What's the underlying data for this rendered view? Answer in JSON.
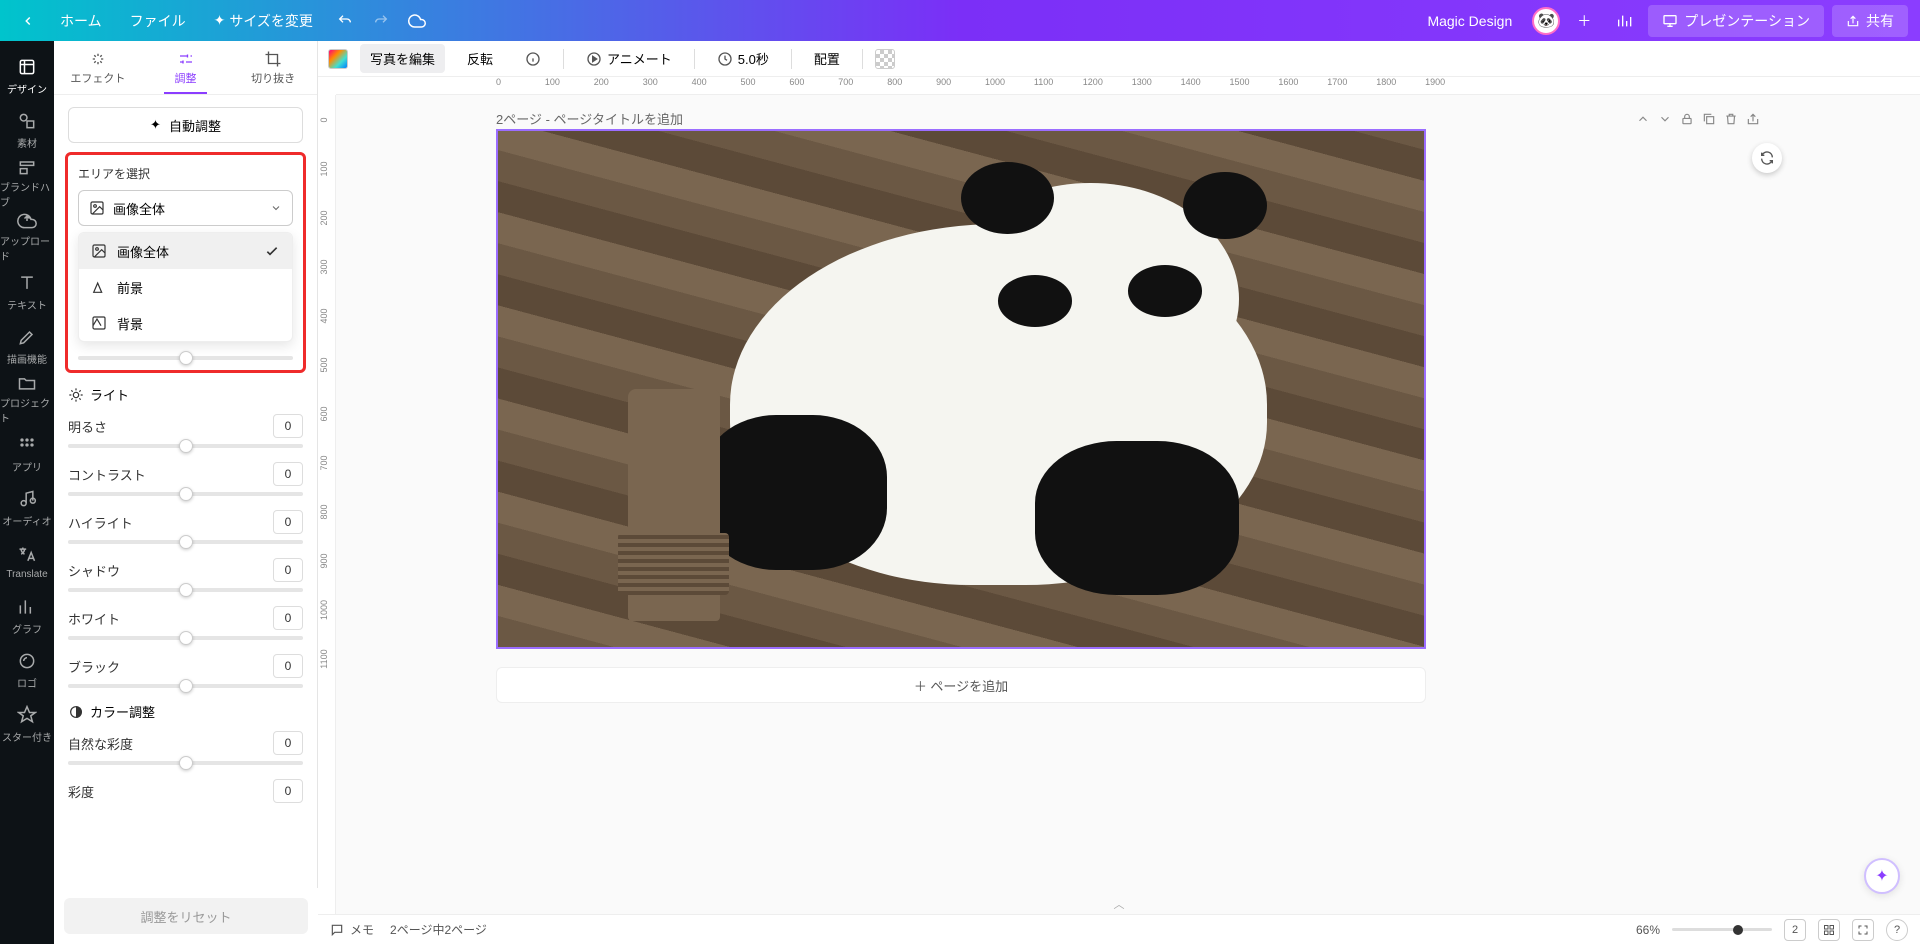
{
  "topbar": {
    "home": "ホーム",
    "file": "ファイル",
    "resize": "サイズを変更",
    "magic": "Magic Design",
    "present": "プレゼンテーション",
    "share": "共有"
  },
  "sidebar": {
    "items": [
      "デザイン",
      "素材",
      "ブランドハブ",
      "アップロード",
      "テキスト",
      "描画機能",
      "プロジェクト",
      "アプリ",
      "オーディオ",
      "Translate",
      "グラフ",
      "ロゴ",
      "スター付き"
    ]
  },
  "panel": {
    "tabs": {
      "effect": "エフェクト",
      "adjust": "調整",
      "crop": "切り抜き"
    },
    "auto": "自動調整",
    "area": {
      "label": "エリアを選択",
      "selected": "画像全体",
      "opt_all": "画像全体",
      "opt_fg": "前景",
      "opt_bg": "背景"
    },
    "light": {
      "head": "ライト",
      "brightness": "明るさ",
      "contrast": "コントラスト",
      "highlight": "ハイライト",
      "shadow": "シャドウ",
      "white": "ホワイト",
      "black": "ブラック"
    },
    "color": {
      "head": "カラー調整",
      "vibrance": "自然な彩度",
      "saturation": "彩度"
    },
    "zero": "0",
    "reset": "調整をリセット"
  },
  "context": {
    "edit": "写真を編集",
    "flip": "反転",
    "animate": "アニメート",
    "duration": "5.0秒",
    "position": "配置"
  },
  "page": {
    "title": "2ページ - ページタイトルを追加",
    "add": "＋ ページを追加"
  },
  "ruler_h": [
    "0",
    "100",
    "200",
    "300",
    "400",
    "500",
    "600",
    "700",
    "800",
    "900",
    "1000",
    "1100",
    "1200",
    "1300",
    "1400",
    "1500",
    "1600",
    "1700",
    "1800",
    "1900"
  ],
  "ruler_v": [
    "0",
    "100",
    "200",
    "300",
    "400",
    "500",
    "600",
    "700",
    "800",
    "900",
    "1000",
    "1100"
  ],
  "bottom": {
    "notes": "メモ",
    "pages": "2ページ中2ページ",
    "zoom": "66%",
    "count": "2"
  }
}
